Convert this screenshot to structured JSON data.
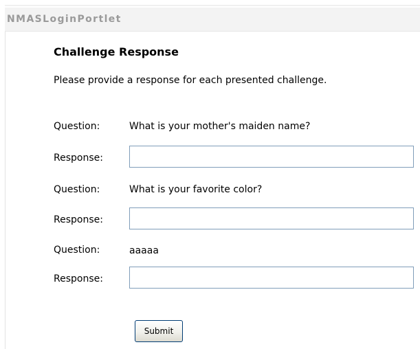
{
  "portlet": {
    "title": "NMASLoginPortlet"
  },
  "form": {
    "title": "Challenge Response",
    "instructions": "Please provide a response for each presented challenge.",
    "question_label": "Question:",
    "response_label": "Response:",
    "challenges": [
      {
        "question": "What is your mother's maiden name?",
        "response_value": ""
      },
      {
        "question": "What is your favorite color?",
        "response_value": ""
      },
      {
        "question": "aaaaa",
        "response_value": ""
      }
    ],
    "submit_label": "Submit"
  }
}
